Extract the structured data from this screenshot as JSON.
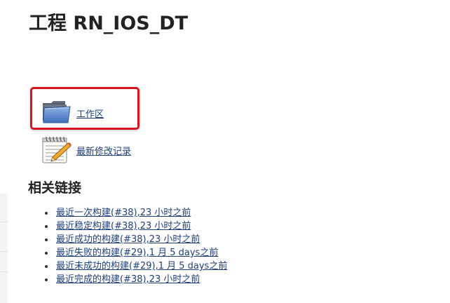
{
  "title": "工程 RN_IOS_DT",
  "tasks": [
    {
      "label": "工作区",
      "icon": "folder-icon"
    },
    {
      "label": "最新修改记录",
      "icon": "notepad-icon"
    }
  ],
  "highlight_color": "#d9131f",
  "link_color": "#1f3f7f",
  "related_links": {
    "heading": "相关链接",
    "items": [
      "最近一次构建(#38),23 小时之前",
      "最近稳定构建(#38),23 小时之前",
      "最近成功的构建(#38),23 小时之前",
      "最近失败的构建(#29),1 月 5 days之前",
      "最近未成功的构建(#29),1 月 5 days之前",
      "最近完成的构建(#38),23 小时之前"
    ]
  }
}
